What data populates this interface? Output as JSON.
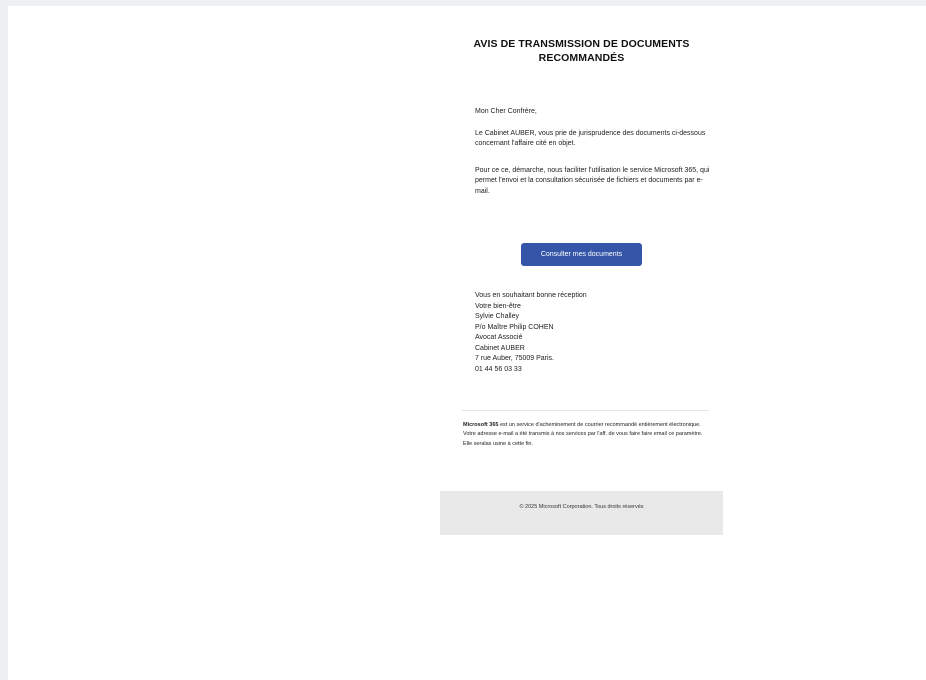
{
  "email": {
    "title_line1": "AVIS DE TRANSMISSION DE DOCUMENTS",
    "title_line2": "RECOMMANDÉS",
    "greeting": "Mon Cher Confrère,",
    "paragraph1": "Le Cabinet AUBER, vous prie de jurisprudence des documents ci-dessous concernant l'affaire cité en objet.",
    "paragraph2": "Pour ce ce, démarche, nous faciliter l'utilisation le service Microsoft 365, qui permet l'envoi et la consultation sécurisée de fichiers et documents par e-mail.",
    "cta_label": "Consulter mes documents",
    "signature": [
      "Vous en souhaitant bonne réception",
      "Votre bien-être",
      "Sylvie Challey",
      "P/o Maître Philip COHEN",
      "Avocat Associé",
      "Cabinet AUBER",
      "7 rue Auber, 75009 Paris.",
      "01 44 56 03 33"
    ],
    "note_brand": "Microsoft 365",
    "note_text": " est un service d'acheminement de courrier recommandé entièrement électronique. Votre adresse e-mail a été transmis à nos services par l'aff. de vous faire faire email ce paramètre. Elle seralas usine à cette fin.",
    "footer": "© 2025 Microsoft Corporation. Tous droits réservés"
  },
  "colors": {
    "button": "#3556a8",
    "footer_bg": "#e9e9e9",
    "page_bg": "#eef0f4"
  }
}
